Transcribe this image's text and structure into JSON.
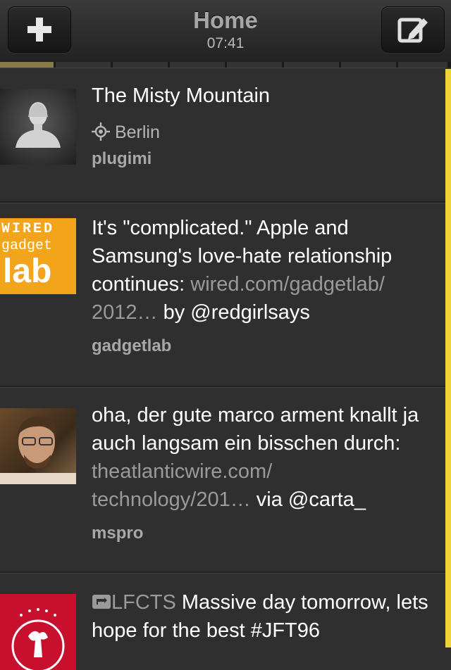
{
  "header": {
    "title": "Home",
    "time": "07:41",
    "left_button_icon": "plus-icon",
    "right_button_icon": "compose-icon"
  },
  "accent": "#f0d33a",
  "tweets": [
    {
      "title": "The Misty Mountain",
      "location": "Berlin",
      "user": "plugimi",
      "avatar": "bust-sculpture"
    },
    {
      "text_before": "It's \"complicated.\" Apple and Samsung's love-hate relationship continues: ",
      "link": "wired.com/gadgetlab/ 2012…",
      "text_after": " by @redgirlsays",
      "user": "gadgetlab",
      "avatar_lines": [
        "WIRED",
        "gadget",
        "lab"
      ]
    },
    {
      "text_before": "oha, der gute marco arment knallt ja auch langsam ein bisschen durch: ",
      "link": "theatlanticwire.com/ technology/201…",
      "text_after": " via @carta_",
      "user": "mspro",
      "avatar": "person-photo"
    },
    {
      "retweet_by": "LFCTS",
      "text": " Massive day tomorrow, lets hope for the best #JFT96",
      "avatar": "liverpool-crest"
    }
  ]
}
